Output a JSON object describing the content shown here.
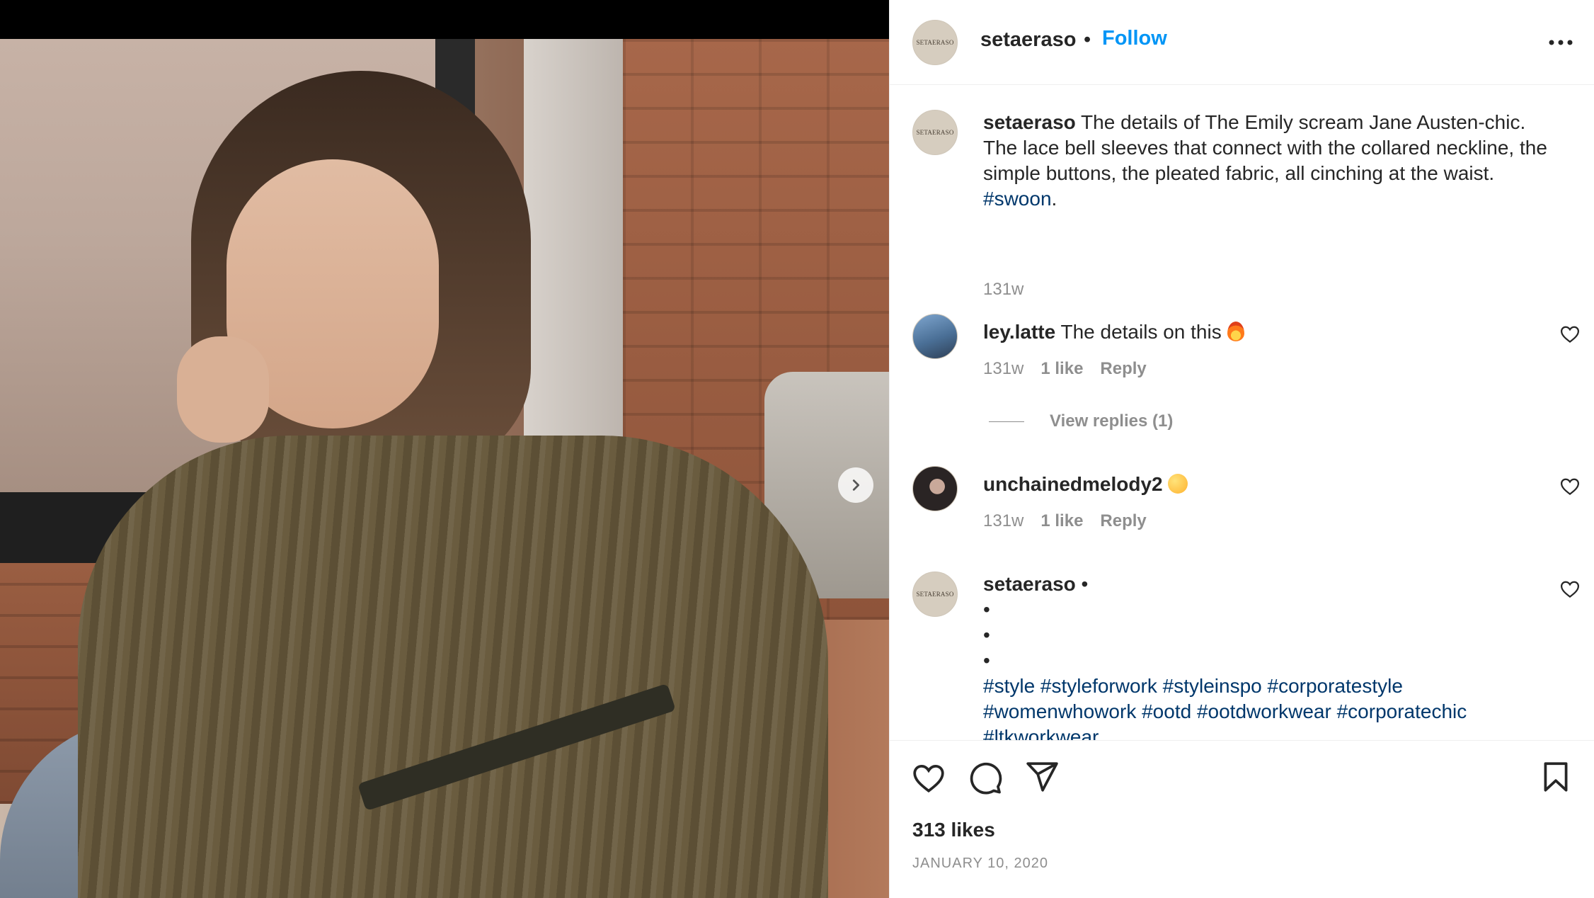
{
  "post": {
    "author": "setaeraso",
    "separator": "•",
    "follow_label": "Follow",
    "avatar_logo_text": "SETAERASO"
  },
  "caption": {
    "username": "setaeraso",
    "text": "The details of The Emily scream Jane Austen-chic. The lace bell sleeves that connect with the collared neckline, the simple buttons, the pleated fabric, all cinching at the waist.",
    "hashtag": "#swoon",
    "hashtag_suffix": ".",
    "time": "131w"
  },
  "comments": [
    {
      "username": "ley.latte",
      "text": "The details on this",
      "emoji": "fire",
      "time": "131w",
      "likes": "1 like",
      "reply_label": "Reply",
      "view_replies": "View replies (1)"
    },
    {
      "username": "unchainedmelody2",
      "text": "",
      "emoji": "smiling-face-with-hearts",
      "time": "131w",
      "likes": "1 like",
      "reply_label": "Reply"
    },
    {
      "username": "setaeraso",
      "separator": "•",
      "bullets": [
        "•",
        "•",
        "•"
      ],
      "hashtags_line1": "#style #styleforwork #styleinspo #corporatestyle",
      "hashtags_line2": "#womenwhowork #ootd #ootdworkwear #corporatechic",
      "hashtags_line3": "#ltkworkwear"
    }
  ],
  "footer": {
    "likes": "313 likes",
    "date": "JANUARY 10, 2020"
  },
  "icons": {
    "more": "more-horizontal-icon",
    "next": "chevron-right-icon",
    "like": "heart-icon",
    "comment": "comment-bubble-icon",
    "share": "paper-plane-icon",
    "save": "bookmark-icon"
  },
  "colors": {
    "follow": "#0095f6",
    "hashtag": "#00376b",
    "secondary_text": "#8e8e8e",
    "primary_text": "#262626"
  }
}
